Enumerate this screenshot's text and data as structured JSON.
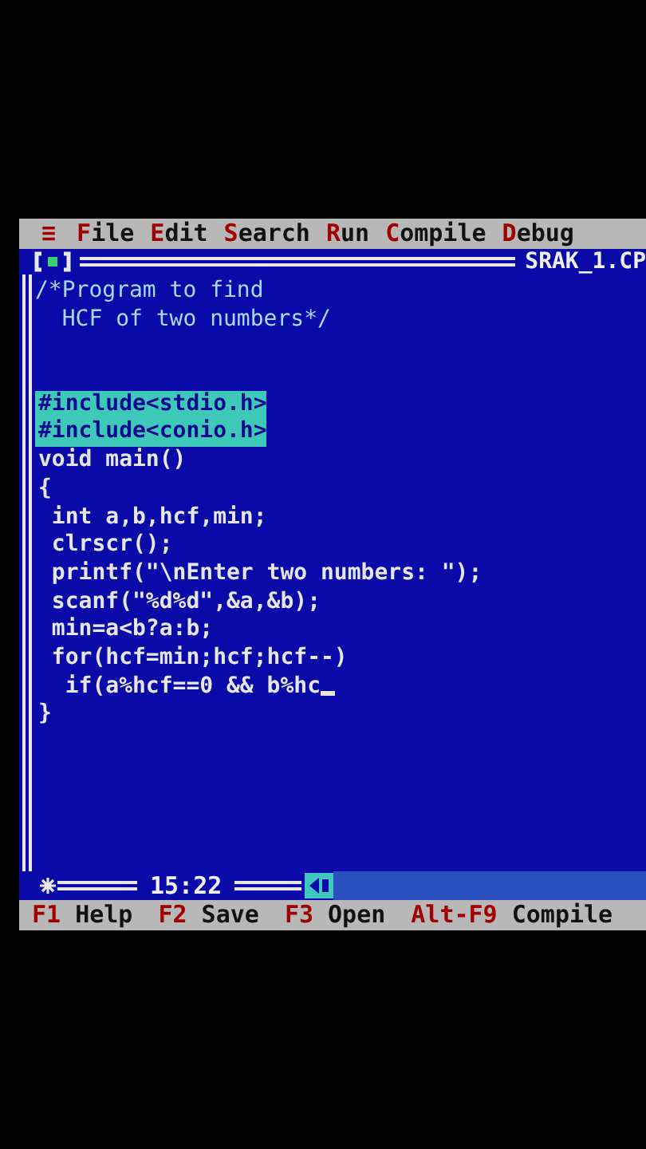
{
  "menu_bar": {
    "system_menu": "≡",
    "items": [
      {
        "label": "File"
      },
      {
        "label": "Edit"
      },
      {
        "label": "Search"
      },
      {
        "label": "Run"
      },
      {
        "label": "Compile"
      },
      {
        "label": "Debug"
      }
    ]
  },
  "editor": {
    "file_name": "SRAK_1.CP",
    "modified": true,
    "position": "15:22",
    "comment_lines": [
      {
        "text": "/*Program to find",
        "selected": false,
        "cursor": false
      },
      {
        "text": "  HCF of two numbers*/",
        "selected": false,
        "cursor": false
      }
    ],
    "code_lines": [
      {
        "text": "#include<stdio.h>",
        "selected": true,
        "cursor": false
      },
      {
        "text": "#include<conio.h>",
        "selected": true,
        "cursor": false
      },
      {
        "text": "void main()",
        "selected": false,
        "cursor": false
      },
      {
        "text": "{",
        "selected": false,
        "cursor": false
      },
      {
        "text": " int a,b,hcf,min;",
        "selected": false,
        "cursor": false
      },
      {
        "text": " clrscr();",
        "selected": false,
        "cursor": false
      },
      {
        "text": " printf(\"\\nEnter two numbers: \");",
        "selected": false,
        "cursor": false
      },
      {
        "text": " scanf(\"%d%d\",&a,&b);",
        "selected": false,
        "cursor": false
      },
      {
        "text": " min=a<b?a:b;",
        "selected": false,
        "cursor": false
      },
      {
        "text": " for(hcf=min;hcf;hcf--)",
        "selected": false,
        "cursor": false
      },
      {
        "text": "  if(a%hcf==0 && b%hc",
        "selected": false,
        "cursor": true
      },
      {
        "text": "}",
        "selected": false,
        "cursor": false
      }
    ]
  },
  "status_bar": [
    {
      "key": "F1",
      "label": "Help"
    },
    {
      "key": "F2",
      "label": "Save"
    },
    {
      "key": "F3",
      "label": "Open"
    },
    {
      "key": "Alt-F9",
      "label": "Compile"
    }
  ]
}
